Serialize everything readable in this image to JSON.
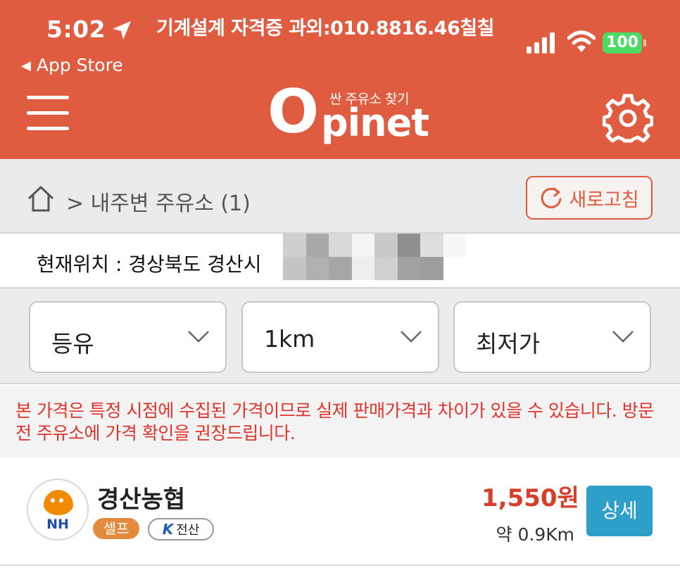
{
  "status_bar": {
    "time": "5:02",
    "message": "기계설계 자격증 과외:010.8816.46칠칠",
    "back_label": "App Store",
    "battery": "100"
  },
  "header": {
    "logo_main": "O",
    "logo_rest": "pinet",
    "logo_sub": "싼 주유소 찾기",
    "colors": {
      "brand": "#e05c41"
    }
  },
  "breadcrumb": {
    "path_text": "> 내주변 주유소 (1)",
    "refresh_label": "새로고침"
  },
  "location": {
    "label": "현재위치 : 경상북도 경산시"
  },
  "filters": {
    "fuel": "등유",
    "radius": "1km",
    "sort": "최저가"
  },
  "notice": "본 가격은 특정 시점에 수집된 가격이므로 실제 판매가격과 차이가 있을 수 있습니다. 방문 전 주유소에 가격 확인을 권장드립니다.",
  "stations": [
    {
      "brand_label": "NH",
      "name": "경산농협",
      "tag_self": "셀프",
      "tag_pay_mark": "K",
      "tag_pay": "전산",
      "price": "1,550원",
      "distance": "약 0.9Km",
      "detail_label": "상세"
    }
  ]
}
